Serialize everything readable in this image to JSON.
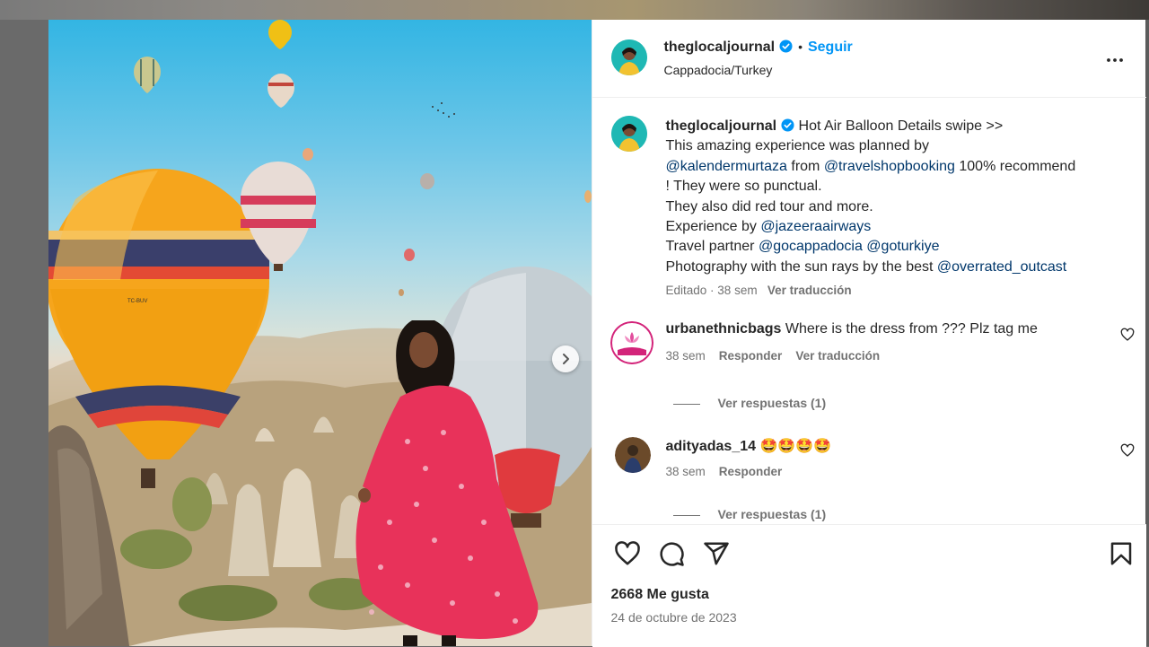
{
  "post": {
    "username": "theglocaljournal",
    "follow_label": "Seguir",
    "separator": "•",
    "location": "Cappadocia/Turkey"
  },
  "caption": {
    "username": "theglocaljournal",
    "line1": "Hot Air Balloon Details swipe >>",
    "line2": "This amazing experience was planned by",
    "mention1": "@kalendermurtaza",
    "from_text": " from ",
    "mention2": "@travelshopbooking",
    "recommend": " 100% recommend",
    "line4": "! They were so punctual.",
    "line5": "They also did red tour and more.",
    "experience_by": "Experience by ",
    "mention3": "@jazeeraairways",
    "travel_partner": "Travel partner ",
    "mention4": "@gocappadocia",
    "mention5": "@goturkiye",
    "photography": "Photography with the sun rays by the best ",
    "mention6": "@overrated_outcast",
    "edited": "Editado",
    "meta_sep": " · ",
    "time": "38 sem",
    "translate": "Ver traducción"
  },
  "comments": [
    {
      "username": "urbanethnicbags",
      "text": "Where is the dress from ??? Plz tag me",
      "time": "38 sem",
      "reply": "Responder",
      "translate": "Ver traducción",
      "replies": "Ver respuestas (1)"
    },
    {
      "username": "adityadas_14",
      "text": "🤩🤩🤩🤩",
      "time": "38 sem",
      "reply": "Responder",
      "replies": "Ver respuestas (1)"
    }
  ],
  "footer": {
    "likes": "2668 Me gusta",
    "date": "24 de octubre de 2023"
  },
  "icons": {
    "verified": "verified-badge-icon",
    "more": "more-options-icon",
    "like": "heart-icon",
    "comment": "comment-icon",
    "share": "send-icon",
    "save": "bookmark-icon",
    "next": "chevron-right-icon"
  },
  "colors": {
    "accent": "#0095f6",
    "mention": "#00376b",
    "text": "#262626",
    "muted": "#737373"
  }
}
